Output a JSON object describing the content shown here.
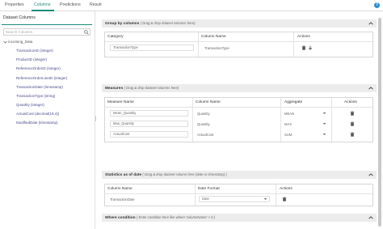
{
  "tabs": [
    {
      "label": "Properties"
    },
    {
      "label": "Columns"
    },
    {
      "label": "Predictions"
    },
    {
      "label": "Result"
    }
  ],
  "help_icon": "?",
  "left_panel": {
    "title": "Dataset Columns",
    "search_placeholder": "Search Columns",
    "root": "incoming_Data",
    "items": [
      "TransactionID (integer)",
      "ProductID (integer)",
      "ReferenceOrderID (integer)",
      "ReferenceOrderLineID (integer)",
      "TransactionDate (timestamp)",
      "TransactionType (string)",
      "Quantity (integer)",
      "ActualCost (decimal(19,4))",
      "ModifiedDate (timestamp)"
    ]
  },
  "group_by": {
    "title": "Group by columns",
    "hint": "( Drag & drop dataset columns here)",
    "headers": [
      "Category",
      "Column Name",
      "Actions"
    ],
    "rows": [
      {
        "category": "TransactionType",
        "column": "TransactionType"
      }
    ]
  },
  "measures": {
    "title": "Measures",
    "hint": "( Drag & drop dataset columns here)",
    "headers": [
      "Measure Name",
      "Column Name",
      "Aggregate",
      "Actions"
    ],
    "rows": [
      {
        "measure": "Mean_Quantity",
        "column": "Quantity",
        "aggregate": "MEAN"
      },
      {
        "measure": "Max_Quantity",
        "column": "Quantity",
        "aggregate": "MAX"
      },
      {
        "measure": "ActualCost",
        "column": "ActualCost",
        "aggregate": "SUM"
      }
    ]
  },
  "stats": {
    "title": "Statistics as of date",
    "hint": "( Drag & drop dataset column here (date or timestamp) )",
    "headers": [
      "Column Name",
      "Date Format",
      "Actions"
    ],
    "rows": [
      {
        "column": "TransactionDate",
        "format": "Date"
      }
    ]
  },
  "where": {
    "title": "Where condition",
    "hint": "( Enter condition here like where 'columnName' > 0 )"
  },
  "colors": {
    "accent": "#1a8a7a",
    "help": "#2b8fd6",
    "section_bg": "#ececec"
  },
  "icons": {
    "delete": "trash-icon",
    "move_down": "arrow-down-icon",
    "collapse": "chevron-up-icon",
    "dropdown": "caret-down-icon",
    "search": "search-icon",
    "tree_toggle": "chevron-down-icon"
  }
}
